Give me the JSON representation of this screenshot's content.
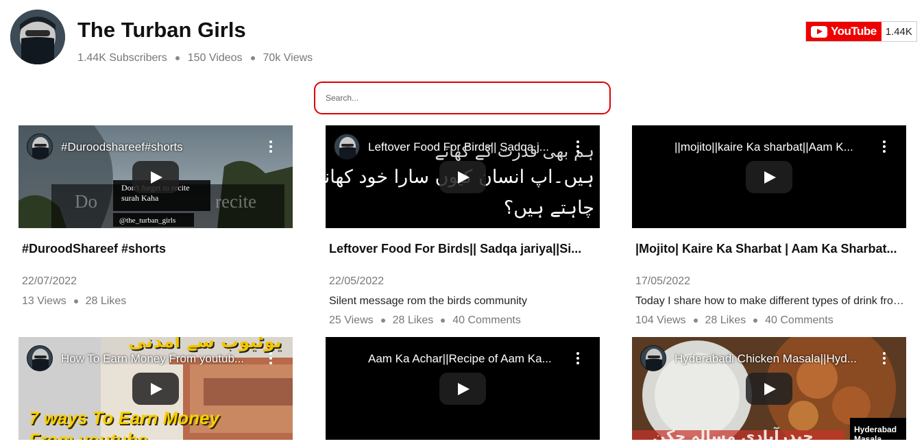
{
  "channel": {
    "name": "The Turban Girls",
    "subscribers": "1.44K Subscribers",
    "videos": "150 Videos",
    "views": "70k Views",
    "youtube_label": "YouTube",
    "youtube_count": "1.44K"
  },
  "search": {
    "placeholder": "Search..."
  },
  "videos": [
    {
      "thumb_title": "#Duroodshareef#shorts",
      "title": "#DuroodShareef #shorts",
      "date": "22/07/2022",
      "description": "",
      "views": "13 Views",
      "likes": "28 Likes",
      "comments": "",
      "overlay_lines": [
        "Don't forget to recite",
        "surah Kaha",
        "@the_turban_girls",
        "Do",
        "recite"
      ]
    },
    {
      "thumb_title": "Leftover Food For Birds|| Sadqa j...",
      "title": "Leftover Food For Birds|| Sadqa jariya||Si...",
      "date": "22/05/2022",
      "description": "Silent message rom the birds community",
      "views": "25 Views",
      "likes": "28 Likes",
      "comments": "40 Comments",
      "overlay_lines": [
        "ہم بھی قدرت کے کھانے",
        "ہیں۔اپ انسان کیوں سارا خود کھانا",
        "چاہتے ہیں؟"
      ]
    },
    {
      "thumb_title": "||mojito||kaire Ka sharbat||Aam K...",
      "title": "|Mojito| Kaire Ka Sharbat | Aam Ka Sharbat...",
      "date": "17/05/2022",
      "description": "Today I share how to make different types of drink from mango...",
      "views": "104 Views",
      "likes": "28 Likes",
      "comments": "40 Comments",
      "overlay_lines": []
    },
    {
      "thumb_title": "How To Earn Money From youtub...",
      "overlay_lines": [
        "یوٹیوب سے آمدنی",
        "7 ways To Earn Money",
        "From youtube"
      ]
    },
    {
      "thumb_title": "Aam Ka Achar||Recipe of Aam Ka...",
      "overlay_lines": []
    },
    {
      "thumb_title": "Hyderabadi Chicken Masala||Hyd...",
      "overlay_lines": [
        "Hyderabad",
        "Masala",
        "حیدرآبادی مسالہ چکن"
      ]
    }
  ],
  "colors": {
    "accent": "#dd0000",
    "youtube_red": "#ee0000"
  }
}
